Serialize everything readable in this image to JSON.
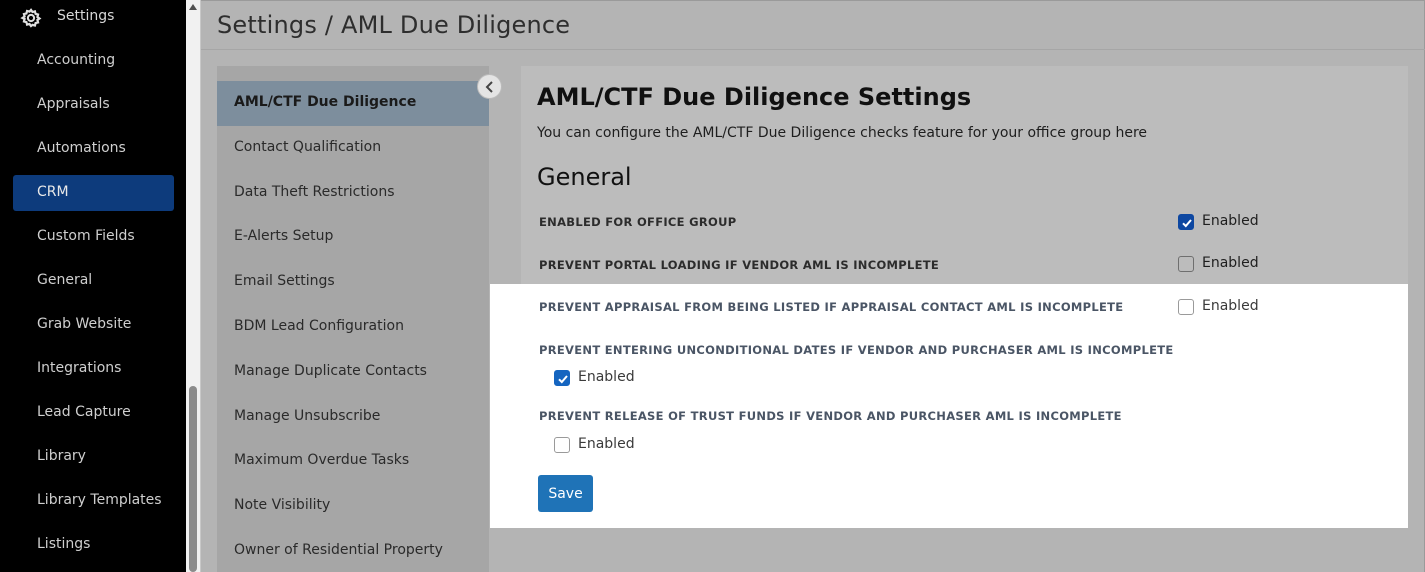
{
  "nav": {
    "header_label": "Settings",
    "header_icon": "gear-icon",
    "items": [
      {
        "label": "Accounting"
      },
      {
        "label": "Appraisals"
      },
      {
        "label": "Automations"
      },
      {
        "label": "CRM"
      },
      {
        "label": "Custom Fields"
      },
      {
        "label": "General"
      },
      {
        "label": "Grab Website"
      },
      {
        "label": "Integrations"
      },
      {
        "label": "Lead Capture"
      },
      {
        "label": "Library"
      },
      {
        "label": "Library Templates"
      },
      {
        "label": "Listings"
      }
    ],
    "active_item": "CRM",
    "active_color": "#0d3b7c"
  },
  "page": {
    "title": "Settings / AML Due Diligence"
  },
  "submenu": {
    "items": [
      {
        "label": "AML/CTF Due Diligence"
      },
      {
        "label": "Contact Qualification"
      },
      {
        "label": "Data Theft Restrictions"
      },
      {
        "label": "E-Alerts Setup"
      },
      {
        "label": "Email Settings"
      },
      {
        "label": "BDM Lead Configuration"
      },
      {
        "label": "Manage Duplicate Contacts"
      },
      {
        "label": "Manage Unsubscribe"
      },
      {
        "label": "Maximum Overdue Tasks"
      },
      {
        "label": "Note Visibility"
      },
      {
        "label": "Owner of Residential Property"
      }
    ],
    "active_item": "AML/CTF Due Diligence",
    "collapse_icon": "chevron-left-icon"
  },
  "settings": {
    "title": "AML/CTF Due Diligence Settings",
    "description": "You can configure the AML/CTF Due Diligence checks feature for your office group here",
    "section": "General",
    "options": [
      {
        "label": "ENABLED FOR OFFICE GROUP",
        "checkbox_label": "Enabled",
        "checked": true
      },
      {
        "label": "PREVENT PORTAL LOADING IF VENDOR AML IS INCOMPLETE",
        "checkbox_label": "Enabled",
        "checked": false
      },
      {
        "label": "PREVENT APPRAISAL FROM BEING LISTED IF APPRAISAL CONTACT AML IS INCOMPLETE",
        "checkbox_label": "Enabled",
        "checked": false
      },
      {
        "label": "PREVENT ENTERING UNCONDITIONAL DATES IF VENDOR AND PURCHASER AML IS INCOMPLETE",
        "checkbox_label": "Enabled",
        "checked": true
      },
      {
        "label": "PREVENT RELEASE OF TRUST FUNDS IF VENDOR AND PURCHASER AML IS INCOMPLETE",
        "checkbox_label": "Enabled",
        "checked": false
      }
    ],
    "save_label": "Save",
    "accent_color": "#1f73b7"
  }
}
